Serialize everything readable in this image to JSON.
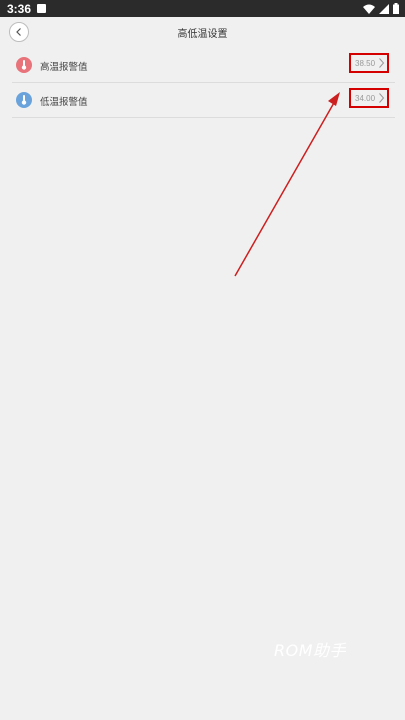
{
  "status_bar": {
    "time": "3:36",
    "icons": [
      "wifi-icon",
      "signal-icon",
      "battery-icon"
    ]
  },
  "header": {
    "title": "高低温设置",
    "back_icon": "chevron-left-icon"
  },
  "settings": [
    {
      "label": "高温报警值",
      "value": "38.50",
      "icon": "thermometer-hot-icon",
      "icon_color": "#e8737a"
    },
    {
      "label": "低温报警值",
      "value": "34.00",
      "icon": "thermometer-cold-icon",
      "icon_color": "#6aa3dc"
    }
  ],
  "annotation": {
    "highlight_color": "#d40000"
  },
  "watermark": "ROM助手"
}
